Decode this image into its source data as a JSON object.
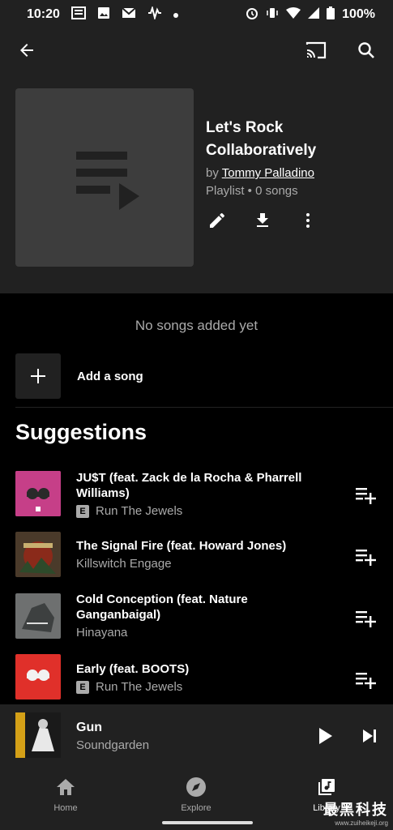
{
  "status": {
    "time": "10:20",
    "battery_text": "100%"
  },
  "playlist": {
    "title": "Let's Rock Collaboratively",
    "by_prefix": "by",
    "owner": "Tommy Palladino",
    "meta": "Playlist • 0 songs"
  },
  "empty_message": "No songs added yet",
  "add_song_label": "Add a song",
  "suggestions_heading": "Suggestions",
  "suggestions": [
    {
      "title": "JU$T (feat. Zack de la Rocha & Pharrell Williams)",
      "explicit": true,
      "explicit_label": "E",
      "artist": "Run The Jewels"
    },
    {
      "title": "The Signal Fire (feat. Howard Jones)",
      "explicit": false,
      "artist": "Killswitch Engage"
    },
    {
      "title": "Cold Conception (feat. Nature Ganganbaigal)",
      "explicit": false,
      "artist": "Hinayana"
    },
    {
      "title": "Early (feat. BOOTS)",
      "explicit": true,
      "explicit_label": "E",
      "artist": "Run The Jewels"
    }
  ],
  "now_playing": {
    "title": "Gun",
    "artist": "Soundgarden"
  },
  "nav": [
    {
      "label": "Home",
      "icon": "home-icon",
      "active": false
    },
    {
      "label": "Explore",
      "icon": "explore-icon",
      "active": false
    },
    {
      "label": "Library",
      "icon": "library-icon",
      "active": true
    }
  ],
  "watermark": {
    "text": "最黑科技",
    "url": "www.zuiheikeji.org"
  },
  "colors": {
    "background": "#000000",
    "surface": "#212121",
    "secondary_text": "#aaaaaa"
  }
}
